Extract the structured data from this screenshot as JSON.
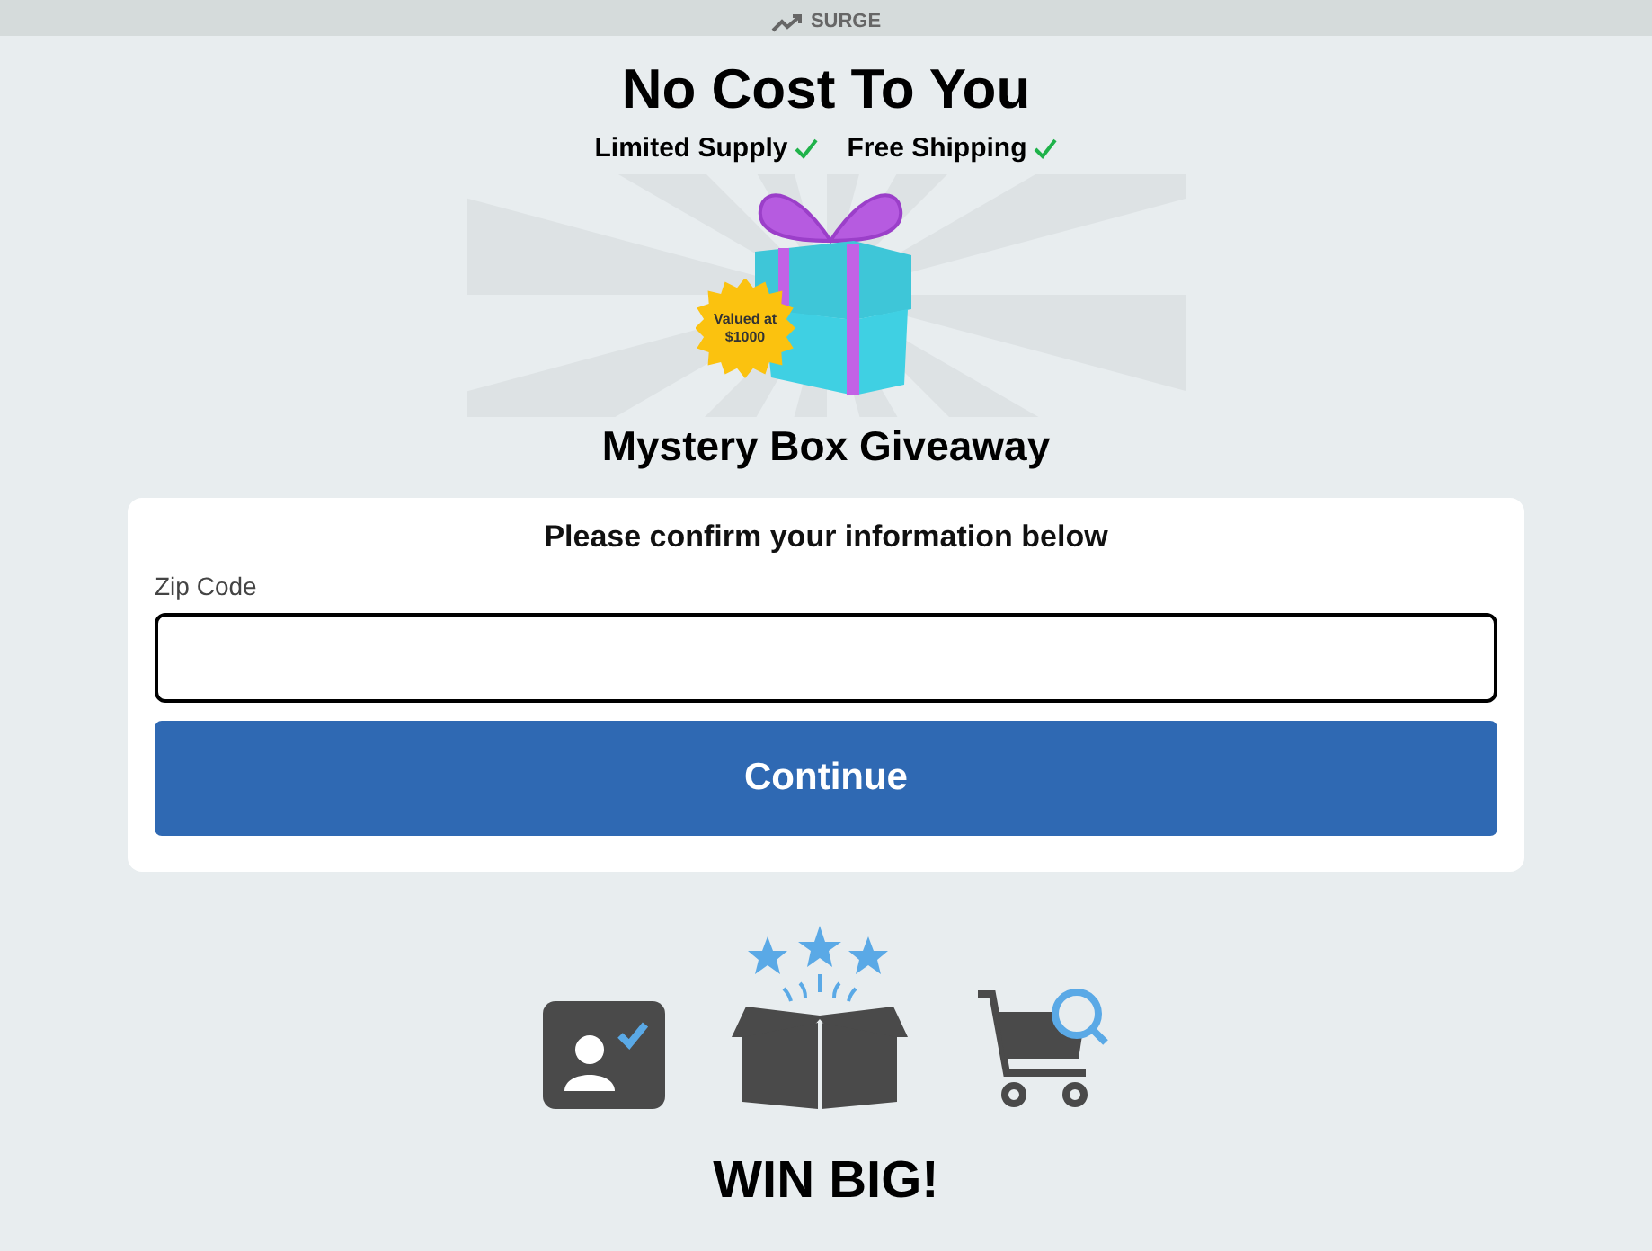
{
  "header": {
    "logo_text": "SURGE"
  },
  "headline": "No Cost To You",
  "perks": [
    {
      "label": "Limited Supply",
      "checked": true
    },
    {
      "label": "Free Shipping",
      "checked": true
    }
  ],
  "prize": {
    "badge_line_1": "Valued at",
    "badge_line_2": "$1000",
    "title": "Mystery Box Giveaway"
  },
  "form": {
    "prompt": "Please confirm your information below",
    "field_label": "Zip Code",
    "button": "Continue"
  },
  "footer_heading": "WIN BIG!"
}
